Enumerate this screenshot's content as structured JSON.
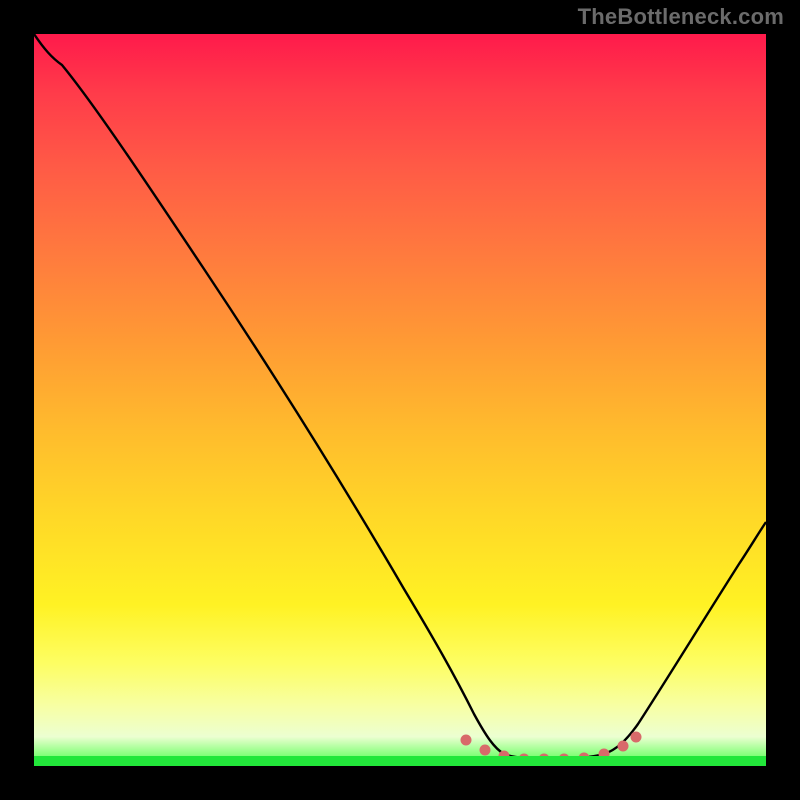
{
  "watermark": "TheBottleneck.com",
  "colors": {
    "background": "#000000",
    "gradient_top": "#ff1a4b",
    "gradient_bottom": "#47ff47",
    "curve_stroke": "#000000",
    "marker": "#d86a6a"
  },
  "chart_data": {
    "type": "line",
    "title": "",
    "xlabel": "",
    "ylabel": "",
    "xlim": [
      0,
      1
    ],
    "ylim": [
      0,
      1
    ],
    "x": [
      0.0,
      0.03,
      0.1,
      0.2,
      0.3,
      0.4,
      0.5,
      0.58,
      0.62,
      0.66,
      0.7,
      0.74,
      0.78,
      0.82,
      0.87,
      0.92,
      0.96,
      1.0
    ],
    "y": [
      1.0,
      0.97,
      0.88,
      0.73,
      0.57,
      0.42,
      0.25,
      0.09,
      0.03,
      0.01,
      0.0,
      0.0,
      0.01,
      0.02,
      0.08,
      0.18,
      0.27,
      0.37
    ],
    "markers": {
      "x": [
        0.585,
        0.61,
        0.64,
        0.67,
        0.7,
        0.73,
        0.76,
        0.79,
        0.815
      ],
      "y": [
        0.035,
        0.022,
        0.014,
        0.01,
        0.01,
        0.012,
        0.016,
        0.023,
        0.035
      ]
    },
    "annotations": []
  }
}
